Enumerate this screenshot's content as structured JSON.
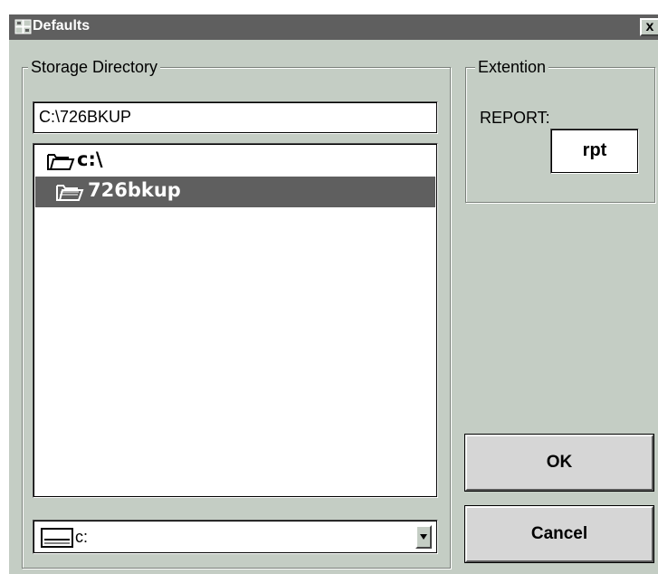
{
  "window": {
    "title": "Defaults",
    "close_label": "x"
  },
  "storage": {
    "group_label": "Storage Directory",
    "path_value": "C:\\726BKUP",
    "tree": [
      {
        "label": "c:\\",
        "selected": false,
        "icon": "open-folder-icon"
      },
      {
        "label": "726bkup",
        "selected": true,
        "icon": "open-folder-icon"
      }
    ],
    "drive": {
      "value": "c:",
      "icon": "drive-icon"
    }
  },
  "extension": {
    "group_label": "Extention",
    "report_label": "REPORT:",
    "report_value": "rpt"
  },
  "buttons": {
    "ok": "OK",
    "cancel": "Cancel"
  },
  "colors": {
    "face": "#c4cdc4",
    "titlebar": "#5f5f5f",
    "selection": "#5f5f5f"
  }
}
